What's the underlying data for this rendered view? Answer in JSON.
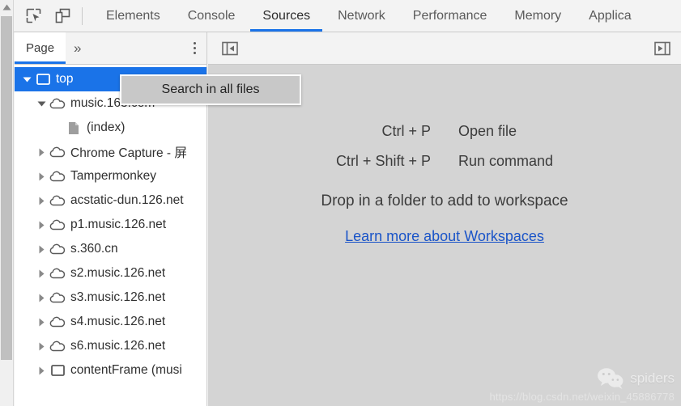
{
  "toolbar": {
    "inspect_icon": "inspect-element-icon",
    "device_icon": "device-toolbar-icon",
    "tabs": [
      {
        "label": "Elements",
        "active": false
      },
      {
        "label": "Console",
        "active": false
      },
      {
        "label": "Sources",
        "active": true
      },
      {
        "label": "Network",
        "active": false
      },
      {
        "label": "Performance",
        "active": false
      },
      {
        "label": "Memory",
        "active": false
      },
      {
        "label": "Applica",
        "active": false
      }
    ],
    "accent_color": "#1a73e8"
  },
  "navigator": {
    "tab_label": "Page",
    "more_tabs_glyph": "»",
    "menu_icon": "kebab-menu-icon",
    "tree": [
      {
        "label": "top",
        "icon": "frame-icon",
        "depth": 0,
        "expanded": true,
        "selected": true,
        "has_children": true
      },
      {
        "label": "music.163.com",
        "icon": "cloud-icon",
        "depth": 1,
        "expanded": true,
        "selected": false,
        "has_children": true
      },
      {
        "label": "(index)",
        "icon": "document-icon",
        "depth": 2,
        "expanded": false,
        "selected": false,
        "has_children": false
      },
      {
        "label": "Chrome Capture - 屏",
        "icon": "cloud-icon",
        "depth": 1,
        "expanded": false,
        "selected": false,
        "has_children": true
      },
      {
        "label": "Tampermonkey",
        "icon": "cloud-icon",
        "depth": 1,
        "expanded": false,
        "selected": false,
        "has_children": true
      },
      {
        "label": "acstatic-dun.126.net",
        "icon": "cloud-icon",
        "depth": 1,
        "expanded": false,
        "selected": false,
        "has_children": true
      },
      {
        "label": "p1.music.126.net",
        "icon": "cloud-icon",
        "depth": 1,
        "expanded": false,
        "selected": false,
        "has_children": true
      },
      {
        "label": "s.360.cn",
        "icon": "cloud-icon",
        "depth": 1,
        "expanded": false,
        "selected": false,
        "has_children": true
      },
      {
        "label": "s2.music.126.net",
        "icon": "cloud-icon",
        "depth": 1,
        "expanded": false,
        "selected": false,
        "has_children": true
      },
      {
        "label": "s3.music.126.net",
        "icon": "cloud-icon",
        "depth": 1,
        "expanded": false,
        "selected": false,
        "has_children": true
      },
      {
        "label": "s4.music.126.net",
        "icon": "cloud-icon",
        "depth": 1,
        "expanded": false,
        "selected": false,
        "has_children": true
      },
      {
        "label": "s6.music.126.net",
        "icon": "cloud-icon",
        "depth": 1,
        "expanded": false,
        "selected": false,
        "has_children": true
      },
      {
        "label": "contentFrame (musi",
        "icon": "frame-icon",
        "depth": 1,
        "expanded": false,
        "selected": false,
        "has_children": true
      }
    ]
  },
  "tooltip": {
    "text": "Search in all files"
  },
  "editor": {
    "show_navigator_icon": "show-navigator-panel-icon",
    "show_debugger_icon": "show-debugger-panel-icon",
    "shortcuts": [
      {
        "keys": "Ctrl + P",
        "description": "Open file"
      },
      {
        "keys": "Ctrl + Shift + P",
        "description": "Run command"
      }
    ],
    "drop_hint": "Drop in a folder to add to workspace",
    "workspaces_link": "Learn more about Workspaces",
    "link_color": "#1a54c8"
  },
  "watermark": {
    "logo_icon": "wechat-icon",
    "name": "spiders",
    "url": "https://blog.csdn.net/weixin_45886778"
  }
}
